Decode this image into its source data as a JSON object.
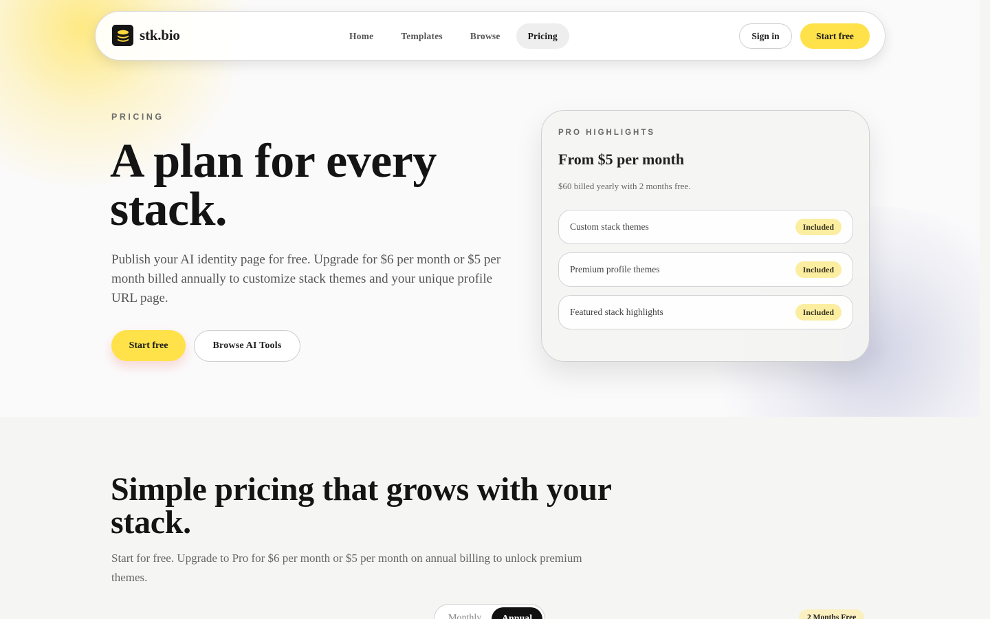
{
  "brand": {
    "name": "stk.bio",
    "accent": "#ffe14a",
    "logo_icon": "stack-layers-icon"
  },
  "nav": {
    "links": [
      {
        "label": "Home",
        "active": false
      },
      {
        "label": "Templates",
        "active": false
      },
      {
        "label": "Browse",
        "active": false
      },
      {
        "label": "Pricing",
        "active": true
      }
    ],
    "sign_in": "Sign in",
    "start_free": "Start free"
  },
  "hero": {
    "eyebrow": "PRICING",
    "title_line1": "A plan for every",
    "title_line2": "stack.",
    "subtitle": "Publish your AI identity page for free. Upgrade for $6 per month or $5 per month billed annually to customize stack themes and your unique profile URL page.",
    "primary_cta": "Start free",
    "secondary_cta": "Browse AI Tools"
  },
  "pro_card": {
    "eyebrow": "PRO HIGHLIGHTS",
    "title": "From $5 per month",
    "note": "$60 billed yearly with 2 months free.",
    "features": [
      {
        "label": "Custom stack themes",
        "badge": "Included"
      },
      {
        "label": "Premium profile themes",
        "badge": "Included"
      },
      {
        "label": "Featured stack highlights",
        "badge": "Included"
      }
    ]
  },
  "pricing_section": {
    "title_line1": "Simple pricing that grows with your",
    "title_line2": "stack.",
    "subtitle": "Start for free. Upgrade to Pro for $6 per month or $5 per month on annual billing to unlock premium themes.",
    "billing_toggle": {
      "monthly": "Monthly",
      "annual": "Annual",
      "selected": "Annual"
    },
    "savings_badge": "2 Months Free"
  }
}
